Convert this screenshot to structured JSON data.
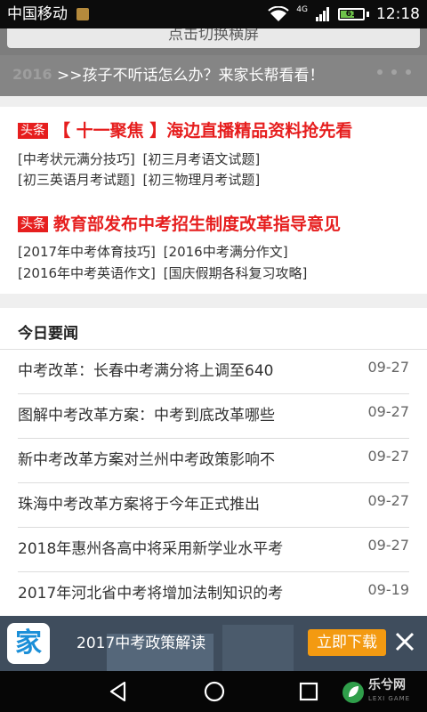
{
  "status_bar": {
    "carrier": "中国移动",
    "network": "4G",
    "battery": "61",
    "time": "12:18"
  },
  "switch_bar": {
    "label": "点击切换横屏"
  },
  "banner": {
    "ghost_text": "2016",
    "message": ">>孩子不听话怎么办？来家长帮看看！"
  },
  "headlines": [
    {
      "tag": "头条",
      "title": "【 十一聚焦 】海边直播精品资料抢先看",
      "links": [
        [
          "[中考状元满分技巧]",
          "[初三月考语文试题]"
        ],
        [
          "[初三英语月考试题]",
          "[初三物理月考试题]"
        ]
      ]
    },
    {
      "tag": "头条",
      "title": "教育部发布中考招生制度改革指导意见",
      "links": [
        [
          "[2017年中考体育技巧]",
          "[2016中考满分作文]"
        ],
        [
          "[2016年中考英语作文]",
          "[国庆假期各科复习攻略]"
        ]
      ]
    }
  ],
  "today_news": {
    "title": "今日要闻",
    "items": [
      {
        "title": "中考改革：长春中考满分将上调至640",
        "date": "09-27"
      },
      {
        "title": "图解中考改革方案：中考到底改革哪些",
        "date": "09-27"
      },
      {
        "title": "新中考改革方案对兰州中考政策影响不",
        "date": "09-27"
      },
      {
        "title": "珠海中考改革方案将于今年正式推出",
        "date": "09-27"
      },
      {
        "title": "2018年惠州各高中将采用新学业水平考",
        "date": "09-27"
      },
      {
        "title": "2017年河北省中考将增加法制知识的考",
        "date": "09-19"
      }
    ]
  },
  "app_banner": {
    "logo_char": "家",
    "label": "2017中考政策解读",
    "download": "立即下载"
  },
  "watermark": {
    "text": "乐兮网",
    "sub": "LEXI GAME"
  },
  "colors": {
    "headline_red": "#e61e1e",
    "download_orange": "#f39a11",
    "banner_gray": "#858585",
    "app_banner_bg": "#3f4d5d"
  },
  "icons": [
    "wifi-icon",
    "signal-icon",
    "battery-icon",
    "close-icon",
    "back-icon",
    "home-icon",
    "recent-apps-icon"
  ]
}
